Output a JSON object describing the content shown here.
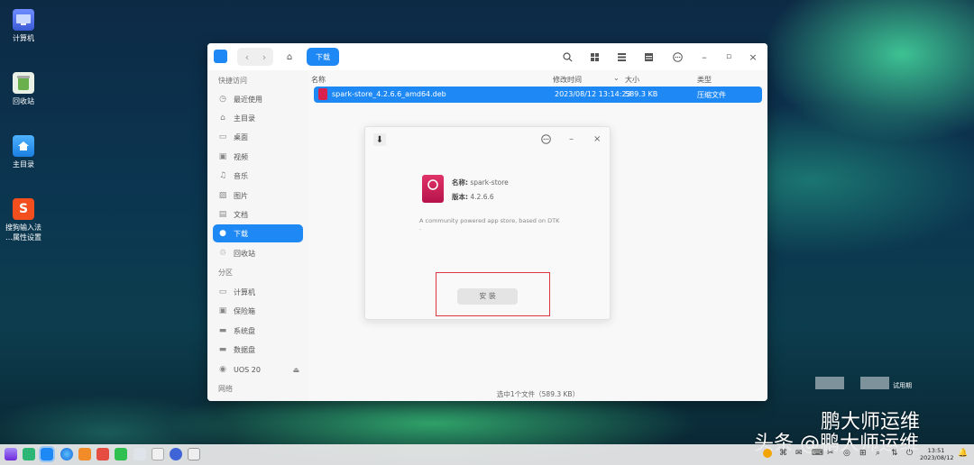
{
  "desktop": {
    "icons": [
      {
        "label": "计算机"
      },
      {
        "label": "回收站"
      },
      {
        "label": "主目录"
      },
      {
        "label": "搜狗输入法\n…属性设置",
        "line1": "搜狗输入法",
        "line2": "…属性设置"
      }
    ],
    "trial_text": "试用期",
    "watermark": "头条 @鹏大师运维",
    "watermark2": "鹏大师运维"
  },
  "file_manager": {
    "breadcrumb": "下载",
    "sidebar": {
      "quick_access_header": "快捷访问",
      "items": [
        {
          "label": "最近使用",
          "icon": "clock-icon"
        },
        {
          "label": "主目录",
          "icon": "home-icon"
        },
        {
          "label": "桌面",
          "icon": "desktop-icon"
        },
        {
          "label": "视频",
          "icon": "video-icon"
        },
        {
          "label": "音乐",
          "icon": "music-icon"
        },
        {
          "label": "图片",
          "icon": "image-icon"
        },
        {
          "label": "文档",
          "icon": "document-icon"
        },
        {
          "label": "下载",
          "icon": "download-icon"
        },
        {
          "label": "回收站",
          "icon": "trash-icon"
        }
      ],
      "partition_header": "分区",
      "partitions": [
        {
          "label": "计算机",
          "icon": "computer-icon"
        },
        {
          "label": "保险箱",
          "icon": "vault-icon"
        },
        {
          "label": "系统盘",
          "icon": "disk-icon"
        },
        {
          "label": "数据盘",
          "icon": "disk-icon"
        },
        {
          "label": "UOS 20",
          "icon": "disk-icon"
        }
      ],
      "network_header": "网络"
    },
    "columns": {
      "name": "名称",
      "modified": "修改时间",
      "size": "大小",
      "type": "类型"
    },
    "files": [
      {
        "name": "spark-store_4.2.6.6_amd64.deb",
        "modified": "2023/08/12 13:14:23",
        "size": "589.3 KB",
        "type": "压缩文件"
      }
    ],
    "status": "选中1个文件（589.3 KB）"
  },
  "installer": {
    "name_label": "名称:",
    "name_value": "spark-store",
    "version_label": "版本:",
    "version_value": "4.2.6.6",
    "description": "A community powered app store, based on DTK",
    "description2": ".",
    "install_button": "安 装"
  },
  "taskbar": {
    "time": "13:51",
    "date": "2023/08/12"
  },
  "colors": {
    "accent": "#1e88f5",
    "highlight_box": "#d9363e"
  }
}
